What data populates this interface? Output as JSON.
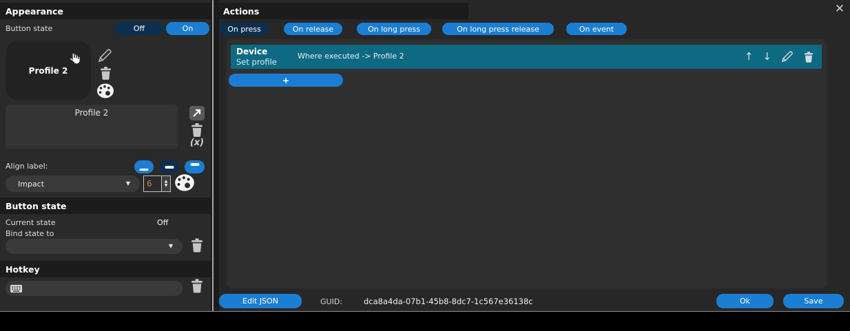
{
  "window": {
    "close_icon": "✕"
  },
  "icons": {
    "chevron_down": "▼",
    "spinner_up": "▲",
    "spinner_down": "▼",
    "move_up_arrow": "↑",
    "move_down_arrow": "↓"
  },
  "colors": {
    "accent_blue": "#1b7ed3",
    "selected_navy": "#0d2f4f",
    "action_row_teal": "#0e6a82",
    "panel_dark": "#2a2a2a"
  },
  "appearance": {
    "section_title": "Appearance",
    "button_state_label": "Button state",
    "toggle": {
      "off": "Off",
      "on": "On"
    },
    "preview_text": "Profile 2",
    "label_value": "Profile 2",
    "clear_label_symbol": "(x)",
    "align_label": "Align label:",
    "font_name": "Impact",
    "font_size": "6"
  },
  "state_section": {
    "section_title": "Button state",
    "current_state_label": "Current state",
    "current_state_value": "Off",
    "bind_state_label": "Bind state to",
    "bind_value": ""
  },
  "hotkey_section": {
    "section_title": "Hotkey",
    "hotkey_value": ""
  },
  "actions": {
    "section_title": "Actions",
    "tabs": [
      {
        "label": "On press",
        "selected": true
      },
      {
        "label": "On release",
        "selected": false
      },
      {
        "label": "On long press",
        "selected": false
      },
      {
        "label": "On long press release",
        "selected": false
      },
      {
        "label": "On event",
        "selected": false
      }
    ],
    "items": [
      {
        "category": "Device",
        "action": "Set profile",
        "description": "Where executed -> Profile 2"
      }
    ],
    "add_button_label": "+"
  },
  "footer": {
    "edit_json_label": "Edit JSON",
    "guid_label": "GUID:",
    "guid_value": "dca8a4da-07b1-45b8-8dc7-1c567e36138c",
    "ok_label": "Ok",
    "save_label": "Save"
  }
}
